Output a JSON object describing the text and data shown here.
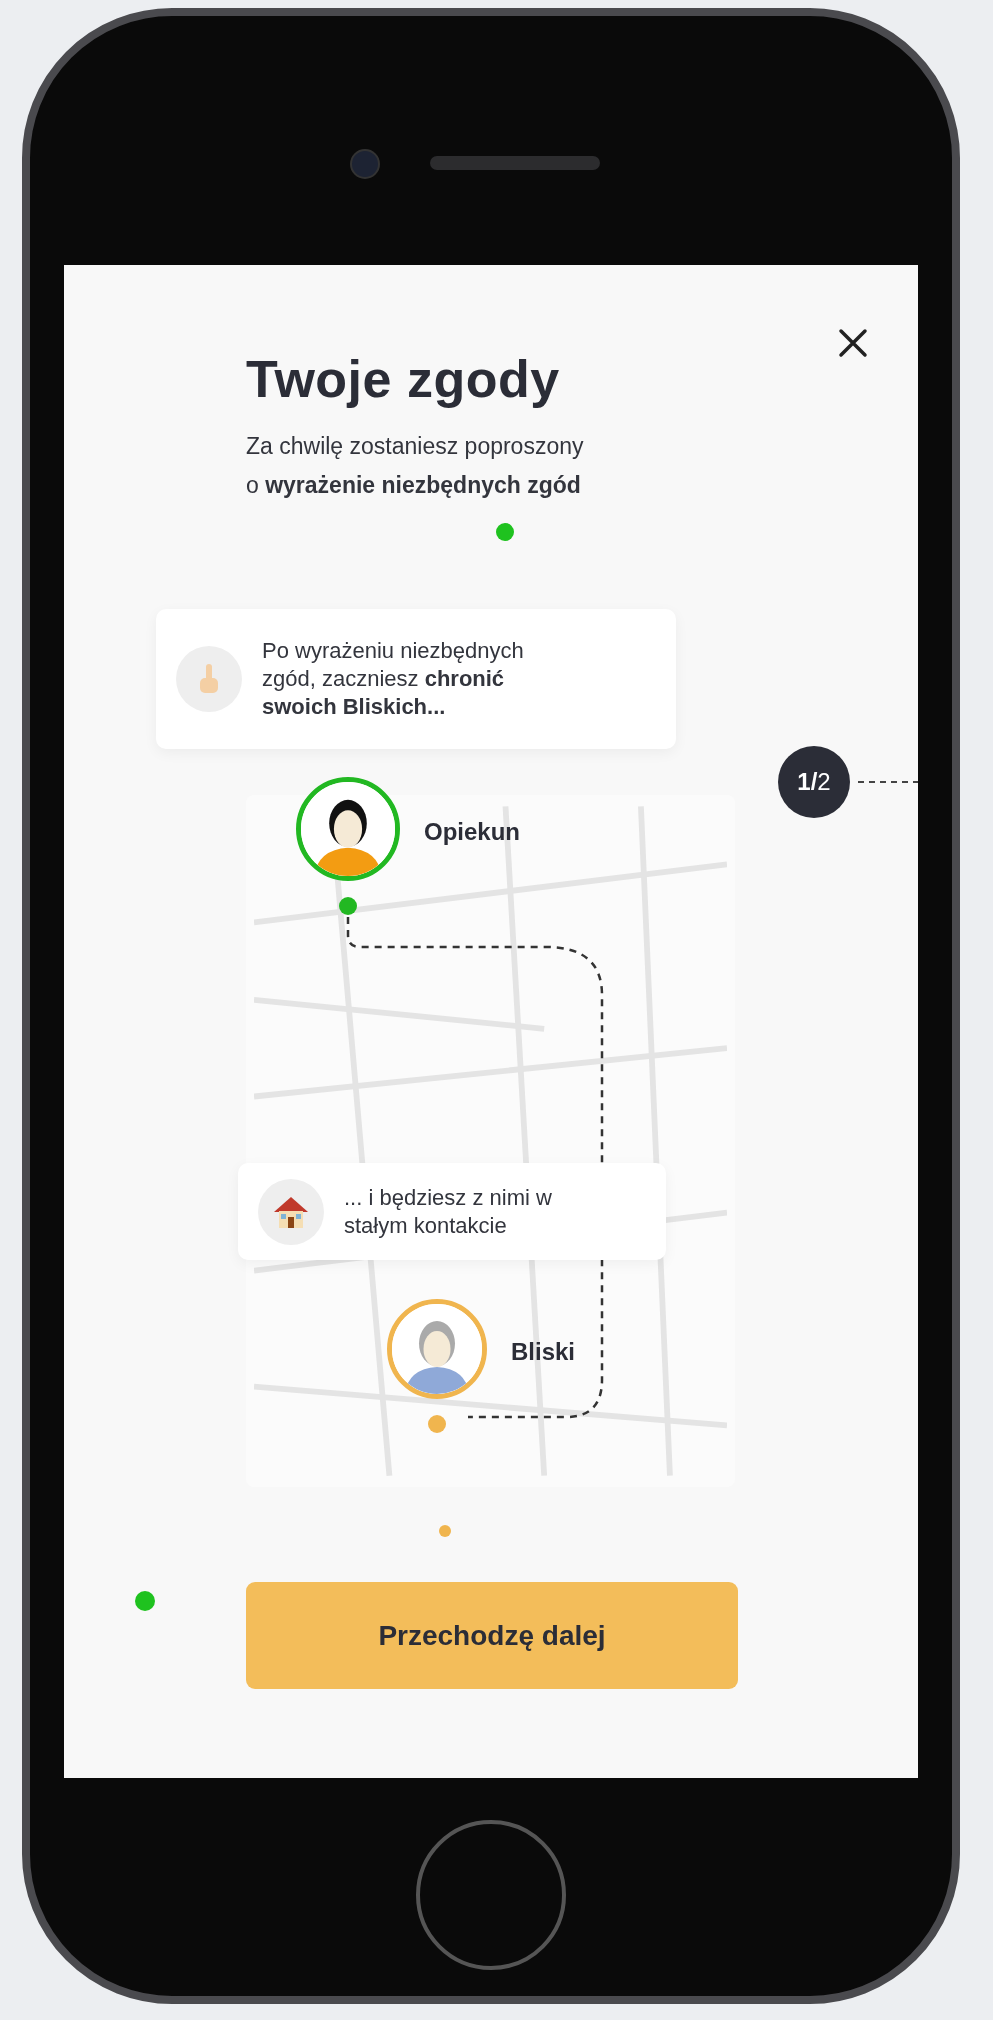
{
  "title": "Twoje zgody",
  "subtitle_lines": [
    "Za chwilę zostaniesz poproszony",
    "o **wyrażenie niezbędnych zgód**"
  ],
  "tips": [
    {
      "kind": "hand",
      "lines": [
        "Po wyrażeniu niezbędnych",
        "zgód, zaczniesz **chronić**",
        "**swoich Bliskich...**"
      ]
    },
    {
      "kind": "house",
      "lines": [
        "... i będziesz z nimi w",
        "stałym kontakcie"
      ]
    }
  ],
  "step_badge": "**1/**2",
  "people": [
    {
      "role": "Opiekun",
      "color": "#22b822"
    },
    {
      "role": "Bliski",
      "color": "#f0b54e"
    }
  ],
  "button": {
    "label": "Przechodzę dalej"
  }
}
